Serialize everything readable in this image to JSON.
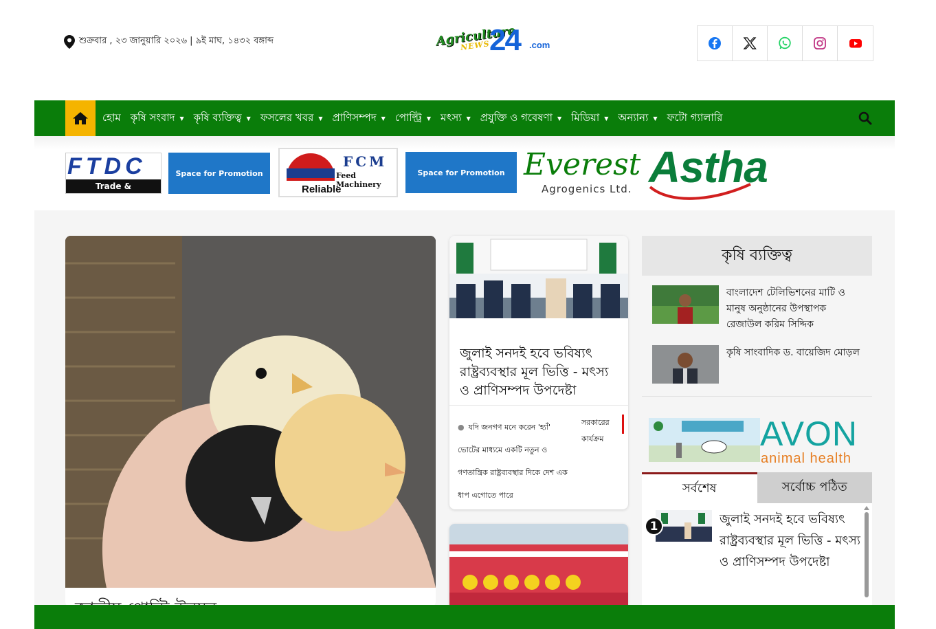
{
  "header": {
    "date_text": "শুক্রবার , ২৩ জানুয়ারি ২০২৬ | ৯ই মাঘ, ১৪৩২ বঙ্গাব্দ",
    "logo": {
      "word1": "Agriculture",
      "word2": "NEWS",
      "number": "24",
      "tld": ".com"
    },
    "social": [
      "facebook-icon",
      "x-icon",
      "whatsapp-icon",
      "instagram-icon",
      "youtube-icon"
    ],
    "social_colors": {
      "facebook": "#1877f2",
      "x": "#111111",
      "whatsapp": "#25d366",
      "instagram": "#c13584",
      "youtube": "#ff0000"
    }
  },
  "nav": {
    "bg_color": "#0a7d0a",
    "home_bg": "#f5b400",
    "items": [
      {
        "label": "হোম",
        "dropdown": false
      },
      {
        "label": "কৃষি সংবাদ",
        "dropdown": true
      },
      {
        "label": "কৃষি ব্যক্তিত্ব",
        "dropdown": true
      },
      {
        "label": "ফসলের খবর",
        "dropdown": true
      },
      {
        "label": "প্রাণিসম্পদ",
        "dropdown": true
      },
      {
        "label": "পোল্ট্রি",
        "dropdown": true
      },
      {
        "label": "মৎস্য",
        "dropdown": true
      },
      {
        "label": "প্রযুক্তি ও গবেষণা",
        "dropdown": true
      },
      {
        "label": "মিডিয়া",
        "dropdown": true
      },
      {
        "label": "অন্যান্য",
        "dropdown": true
      },
      {
        "label": "ফটো গ্যালারি",
        "dropdown": false
      }
    ]
  },
  "ads": {
    "ftdc": {
      "logo": "FTDC",
      "tagline": "Trade & Consultation"
    },
    "promo1": "Space for Promotion",
    "fcm": {
      "name": "FCM",
      "sub": "Feed Machinery",
      "tag": "Reliable"
    },
    "promo2": "Space for Promotion",
    "everest": {
      "name": "Everest",
      "sub": "Agrogenics Ltd."
    },
    "astha": {
      "name": "Astha"
    },
    "avon": {
      "name": "AVON",
      "sub": "animal health"
    }
  },
  "lead": {
    "title": "জাতীয় পোল্ট্রি উন্নয়ন"
  },
  "mid": {
    "title": "জুলাই সনদই হবে ভবিষ্যৎ রাষ্ট্রব্যবস্থার মূল ভিত্তি - মৎস্য ও প্রাণিসম্পদ উপদেষ্টা",
    "quote": "যদি জনগণ মনে করেন 'হ্যাঁ' ভোটের মাধ্যমে একটি নতুন ও গণতান্ত্রিক রাষ্ট্রব্যবস্থার দিকে দেশ এক ধাপ এগোতে পারে",
    "category": "সরকারের কার্যক্রম"
  },
  "sidebar": {
    "heading": "কৃষি ব্যক্তিত্ব",
    "people": [
      {
        "name": "বাংলাদেশ টেলিভিশনের মাটি ও মানুষ অনুষ্ঠানের উপস্থাপক রেজাউল করিম সিদ্দিক"
      },
      {
        "name": "কৃষি সাংবাদিক ড. বায়েজিদ মোড়ল"
      }
    ],
    "tabs": {
      "latest": "সর্বশেষ",
      "most_read": "সর্বোচ্চ পঠিত"
    },
    "latest": [
      {
        "rank": "1",
        "title": "জুলাই সনদই হবে ভবিষ্যৎ রাষ্ট্রব্যবস্থার মূল ভিত্তি - মৎস্য ও প্রাণিসম্পদ উপদেষ্টা"
      }
    ]
  }
}
